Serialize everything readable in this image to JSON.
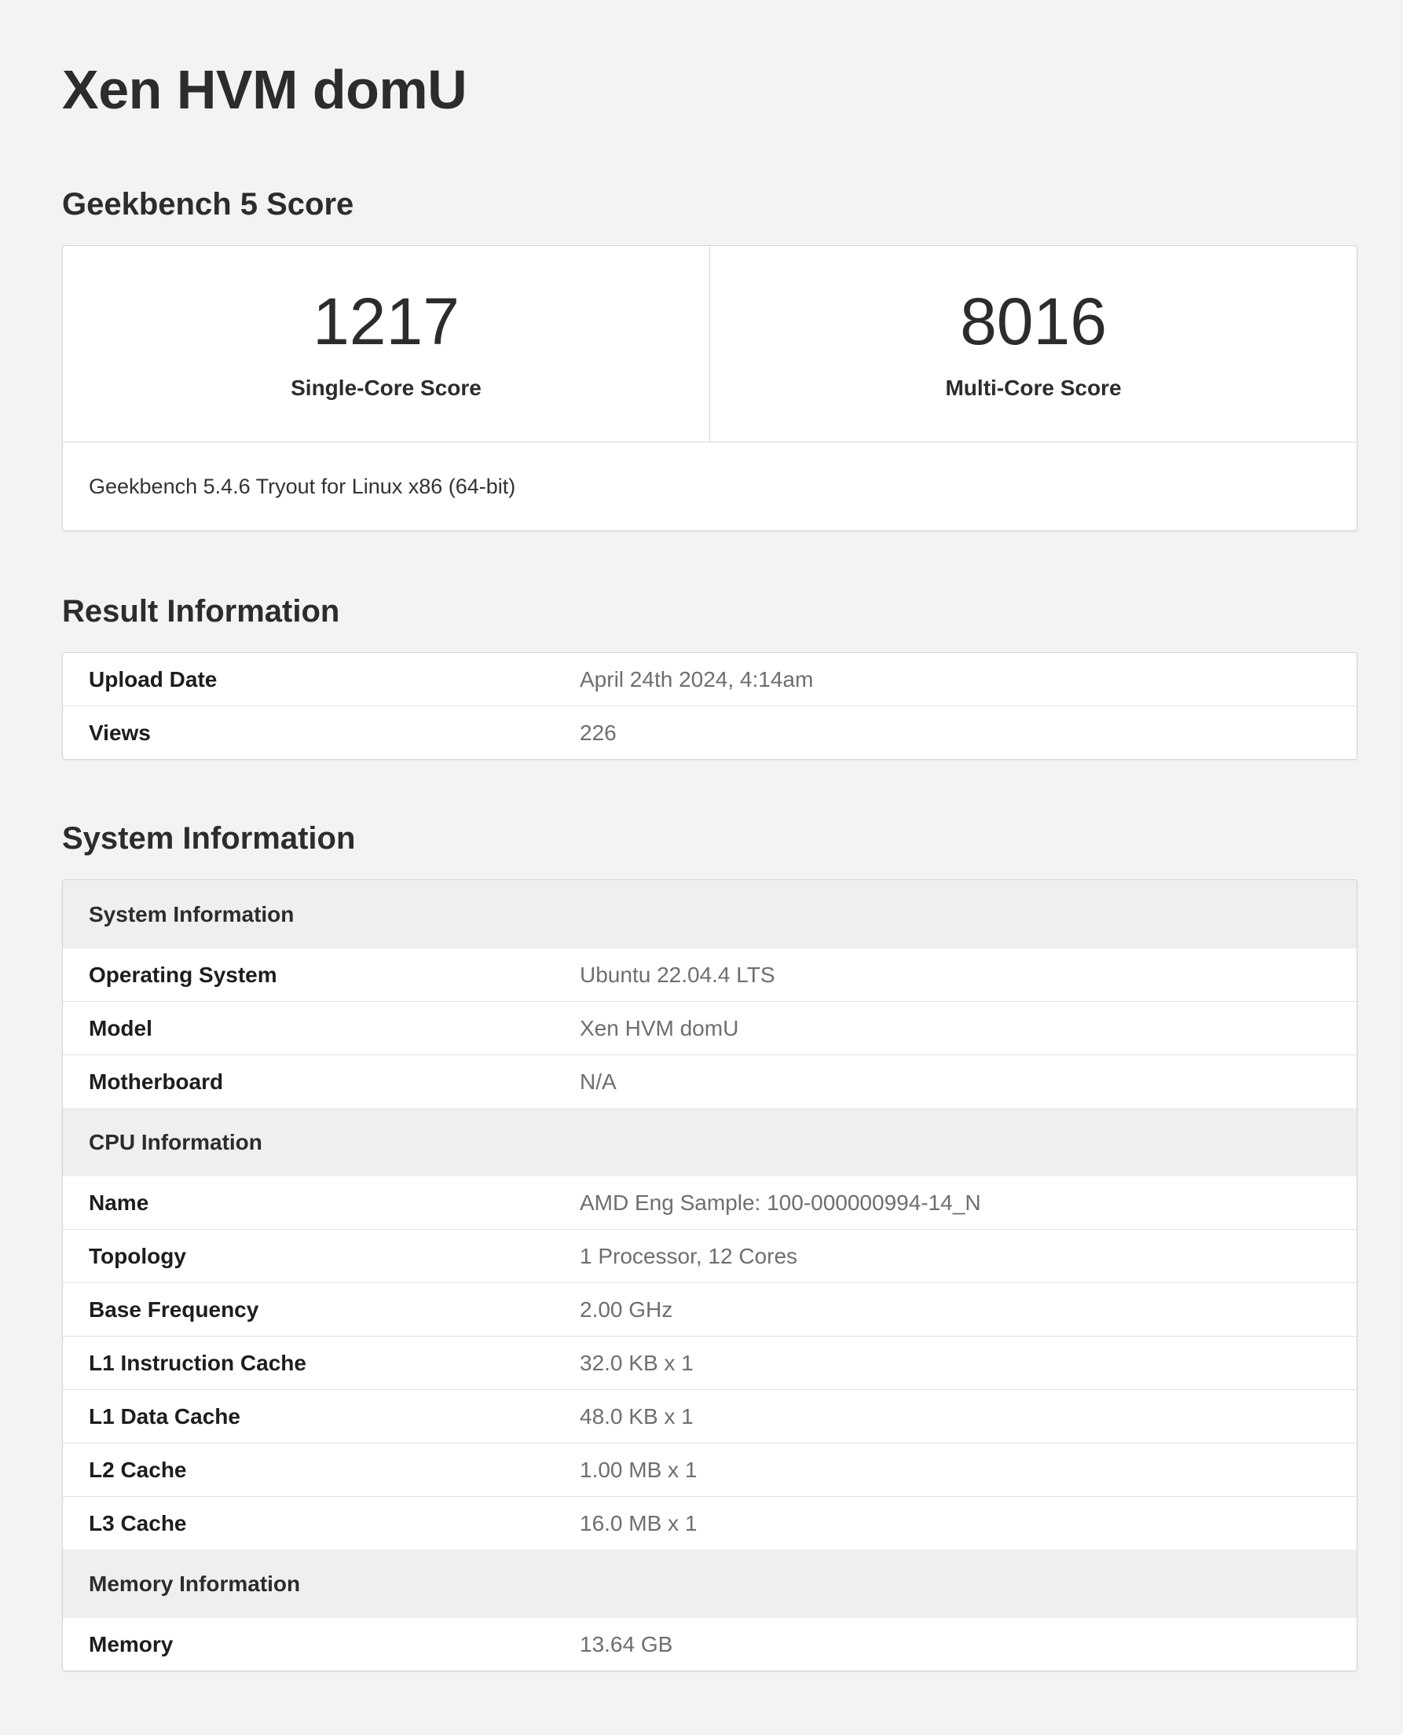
{
  "page": {
    "title": "Xen HVM domU"
  },
  "score_section": {
    "title": "Geekbench 5 Score",
    "single_core": {
      "value": "1217",
      "label": "Single-Core Score"
    },
    "multi_core": {
      "value": "8016",
      "label": "Multi-Core Score"
    },
    "version_text": "Geekbench 5.4.6 Tryout for Linux x86 (64-bit)"
  },
  "result_section": {
    "title": "Result Information",
    "rows": [
      {
        "key": "Upload Date",
        "value": "April 24th 2024, 4:14am"
      },
      {
        "key": "Views",
        "value": "226"
      }
    ]
  },
  "system_section": {
    "title": "System Information",
    "groups": [
      {
        "header": "System Information",
        "rows": [
          {
            "key": "Operating System",
            "value": "Ubuntu 22.04.4 LTS"
          },
          {
            "key": "Model",
            "value": "Xen HVM domU"
          },
          {
            "key": "Motherboard",
            "value": "N/A"
          }
        ]
      },
      {
        "header": "CPU Information",
        "rows": [
          {
            "key": "Name",
            "value": "AMD Eng Sample: 100-000000994-14_N"
          },
          {
            "key": "Topology",
            "value": "1 Processor, 12 Cores"
          },
          {
            "key": "Base Frequency",
            "value": "2.00 GHz"
          },
          {
            "key": "L1 Instruction Cache",
            "value": "32.0 KB x 1"
          },
          {
            "key": "L1 Data Cache",
            "value": "48.0 KB x 1"
          },
          {
            "key": "L2 Cache",
            "value": "1.00 MB x 1"
          },
          {
            "key": "L3 Cache",
            "value": "16.0 MB x 1"
          }
        ]
      },
      {
        "header": "Memory Information",
        "rows": [
          {
            "key": "Memory",
            "value": "13.64 GB"
          }
        ]
      }
    ]
  }
}
